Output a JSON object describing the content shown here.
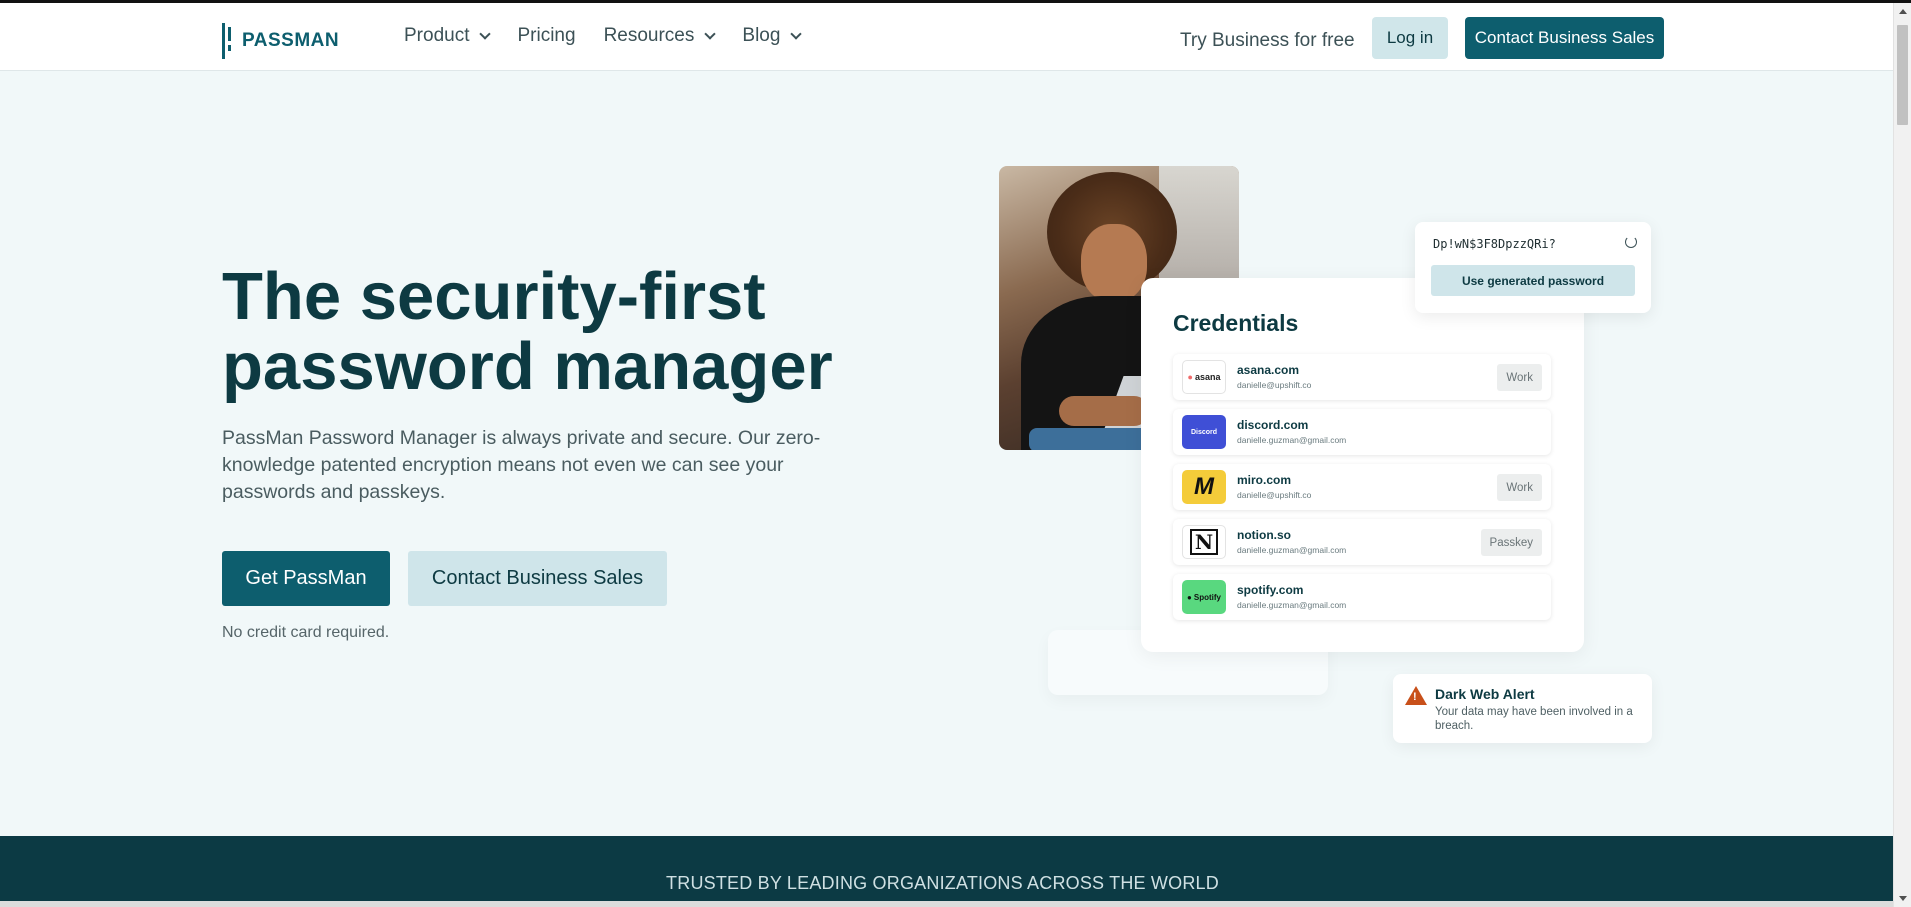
{
  "brand": {
    "name": "PASSMAN",
    "accent": "#0d5e6e",
    "dark": "#0c3a44"
  },
  "nav": {
    "items": [
      {
        "label": "Product",
        "dropdown": true
      },
      {
        "label": "Pricing",
        "dropdown": false
      },
      {
        "label": "Resources",
        "dropdown": true
      },
      {
        "label": "Blog",
        "dropdown": true
      }
    ],
    "try_business": "Try Business for free",
    "login": "Log in",
    "contact_sales": "Contact Business Sales"
  },
  "hero": {
    "title_line1": "The security-first",
    "title_line2": "password manager",
    "description": "PassMan Password Manager is always private and secure. Our zero-knowledge patented encryption means not even we can see your passwords and passkeys.",
    "primary_cta": "Get PassMan",
    "secondary_cta": "Contact Business Sales",
    "note": "No credit card required."
  },
  "generator": {
    "password": "Dp!wN$3F8DpzzQRi?",
    "button": "Use generated password"
  },
  "credentials": {
    "title": "Credentials",
    "items": [
      {
        "site": "asana.com",
        "email": "danielle@upshift.co",
        "tag": "Work",
        "logo_text": "asana"
      },
      {
        "site": "discord.com",
        "email": "danielle.guzman@gmail.com",
        "tag": "",
        "logo_text": "Discord"
      },
      {
        "site": "miro.com",
        "email": "danielle@upshift.co",
        "tag": "Work",
        "logo_text": "M"
      },
      {
        "site": "notion.so",
        "email": "danielle.guzman@gmail.com",
        "tag": "Passkey",
        "logo_text": "N"
      },
      {
        "site": "spotify.com",
        "email": "danielle.guzman@gmail.com",
        "tag": "",
        "logo_text": "Spotify"
      }
    ]
  },
  "alert": {
    "title": "Dark Web Alert",
    "text": "Your data may have been involved in a breach."
  },
  "trusted": {
    "text": "TRUSTED BY LEADING ORGANIZATIONS ACROSS THE WORLD"
  }
}
